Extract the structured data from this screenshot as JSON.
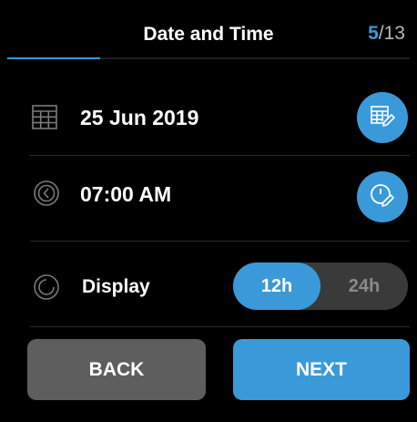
{
  "header": {
    "title": "Date and Time",
    "step_current": "5",
    "step_total": "/13",
    "progress_fraction": 0.23
  },
  "date_row": {
    "value": "25 Jun 2019",
    "icon": "calendar-icon",
    "edit_icon": "edit-calendar-icon"
  },
  "time_row": {
    "value": "07:00 AM",
    "icon": "clock-icon",
    "edit_icon": "edit-clock-icon"
  },
  "display_row": {
    "label": "Display",
    "icon": "circle-icon",
    "options": [
      "12h",
      "24h"
    ],
    "selected": "12h"
  },
  "footer": {
    "back_label": "BACK",
    "next_label": "NEXT"
  },
  "colors": {
    "accent": "#3a9ad9",
    "background": "#000000",
    "back_button": "#5e5e5e",
    "toggle_track": "#3a3a3a"
  }
}
